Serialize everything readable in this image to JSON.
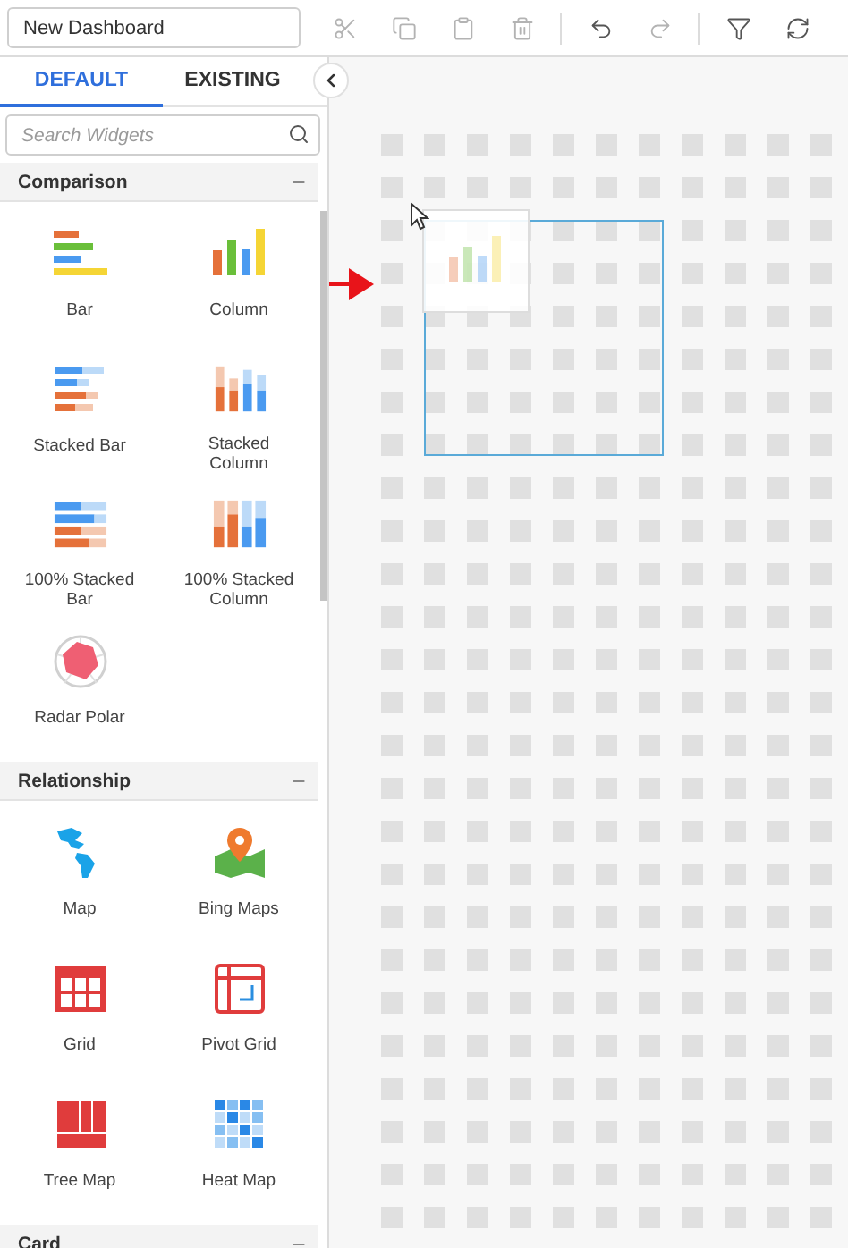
{
  "toolbar": {
    "title_field": {
      "value": "New Dashboard"
    },
    "tool_groups": [
      [
        {
          "kind": "cut",
          "disabled": true
        },
        {
          "kind": "copy",
          "disabled": true
        },
        {
          "kind": "paste",
          "disabled": true
        },
        {
          "kind": "delete",
          "disabled": true
        }
      ],
      [
        {
          "kind": "undo",
          "disabled": false
        },
        {
          "kind": "redo",
          "disabled": true
        }
      ],
      [
        {
          "kind": "filter",
          "disabled": false
        },
        {
          "kind": "refresh",
          "disabled": false
        }
      ]
    ]
  },
  "tabs": [
    {
      "label": "DEFAULT",
      "selected": true
    },
    {
      "label": "EXISTING",
      "selected": false
    }
  ],
  "search": {
    "placeholder": "Search Widgets"
  },
  "sections": [
    {
      "title": "Comparison",
      "expanded": true,
      "widgets": [
        {
          "label": "Bar",
          "kind": "bar"
        },
        {
          "label": "Column",
          "kind": "column"
        },
        {
          "label": "Stacked Bar",
          "kind": "stacked_bar"
        },
        {
          "label": "Stacked Column",
          "kind": "stacked_column"
        },
        {
          "label": "100% Stacked Bar",
          "kind": "stacked_bar_100"
        },
        {
          "label": "100% Stacked Column",
          "kind": "stacked_column_100"
        },
        {
          "label": "Radar Polar",
          "kind": "radar"
        }
      ]
    },
    {
      "title": "Relationship",
      "expanded": true,
      "widgets": [
        {
          "label": "Map",
          "kind": "map"
        },
        {
          "label": "Bing Maps",
          "kind": "bing_maps"
        },
        {
          "label": "Grid",
          "kind": "grid"
        },
        {
          "label": "Pivot Grid",
          "kind": "pivot_grid"
        },
        {
          "label": "Tree Map",
          "kind": "tree_map"
        },
        {
          "label": "Heat Map",
          "kind": "heat_map"
        }
      ]
    },
    {
      "title": "Card",
      "expanded": true
    }
  ]
}
